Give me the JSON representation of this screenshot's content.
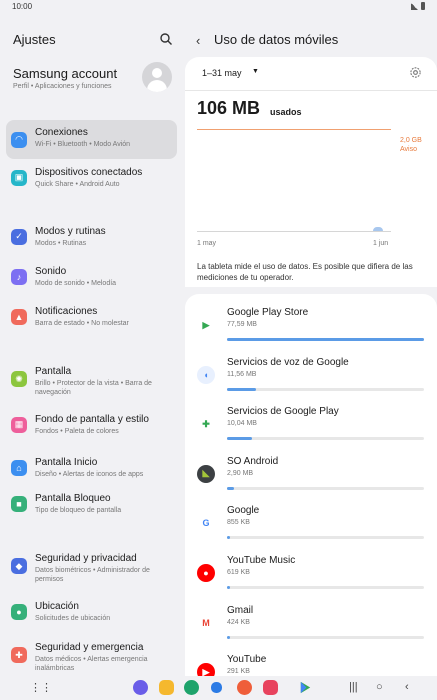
{
  "status": {
    "time": "10:00"
  },
  "left": {
    "title": "Ajustes",
    "account": {
      "name": "Samsung account",
      "sub": "Perfil • Aplicaciones y funciones"
    },
    "items": [
      {
        "label": "Conexiones",
        "sub": "Wi-Fi • Bluetooth • Modo Avión",
        "icon": "wifi-icon",
        "color": "#3c8ff0",
        "selected": true
      },
      {
        "label": "Dispositivos conectados",
        "sub": "Quick Share • Android Auto",
        "icon": "devices-icon",
        "color": "#25b6c9"
      },
      {
        "label": "Modos y rutinas",
        "sub": "Modos • Rutinas",
        "icon": "check-circle-icon",
        "color": "#4a6ee0"
      },
      {
        "label": "Sonido",
        "sub": "Modo de sonido • Melodía",
        "icon": "sound-icon",
        "color": "#7d6ff2"
      },
      {
        "label": "Notificaciones",
        "sub": "Barra de estado • No molestar",
        "icon": "bell-icon",
        "color": "#f06a5c"
      },
      {
        "label": "Pantalla",
        "sub": "Brillo • Protector de la vista • Barra de navegación",
        "icon": "sun-icon",
        "color": "#8cc63e"
      },
      {
        "label": "Fondo de pantalla y estilo",
        "sub": "Fondos • Paleta de colores",
        "icon": "wallpaper-icon",
        "color": "#ee5f9b"
      },
      {
        "label": "Pantalla Inicio",
        "sub": "Diseño • Alertas de iconos de apps",
        "icon": "home-icon",
        "color": "#3c8ff0"
      },
      {
        "label": "Pantalla Bloqueo",
        "sub": "Tipo de bloqueo de pantalla",
        "icon": "lock-icon",
        "color": "#36b07a"
      },
      {
        "label": "Seguridad y privacidad",
        "sub": "Datos biométricos • Administrador de permisos",
        "icon": "shield-icon",
        "color": "#4a6ee0"
      },
      {
        "label": "Ubicación",
        "sub": "Solicitudes de ubicación",
        "icon": "location-icon",
        "color": "#36b07a"
      },
      {
        "label": "Seguridad y emergencia",
        "sub": "Datos médicos • Alertas emergencia inalámbricas",
        "icon": "emergency-icon",
        "color": "#f06a5c"
      }
    ]
  },
  "right": {
    "title": "Uso de datos móviles",
    "period": "1–31 may",
    "usage_value": "106 MB",
    "usage_unit": "usados",
    "warning_value": "2,0 GB",
    "warning_label": "Aviso",
    "x_start": "1 may",
    "x_end": "1 jun",
    "explanation": "La tableta mide el uso de datos. Es posible que difiera de las mediciones de tu operador.",
    "apps": [
      {
        "name": "Google Play Store",
        "size": "77,59 MB",
        "fraction": 1.0,
        "icon": "play-store-icon"
      },
      {
        "name": "Servicios de voz de Google",
        "size": "11,56 MB",
        "fraction": 0.149,
        "icon": "voice-icon"
      },
      {
        "name": "Servicios de Google Play",
        "size": "10,04 MB",
        "fraction": 0.129,
        "icon": "play-services-icon"
      },
      {
        "name": "SO Android",
        "size": "2,90 MB",
        "fraction": 0.037,
        "icon": "android-icon"
      },
      {
        "name": "Google",
        "size": "855 KB",
        "fraction": 0.011,
        "icon": "google-icon"
      },
      {
        "name": "YouTube Music",
        "size": "619 KB",
        "fraction": 0.008,
        "icon": "youtube-music-icon"
      },
      {
        "name": "Gmail",
        "size": "424 KB",
        "fraction": 0.005,
        "icon": "gmail-icon"
      },
      {
        "name": "YouTube",
        "size": "291 KB",
        "fraction": 0.004,
        "icon": "youtube-icon"
      }
    ]
  }
}
